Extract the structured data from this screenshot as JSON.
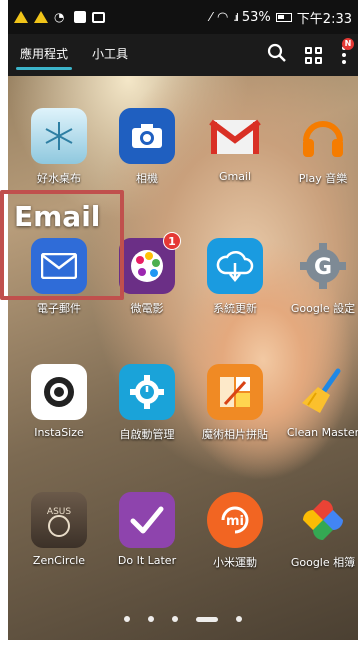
{
  "status_bar": {
    "battery": "53%",
    "time": "下午2:33"
  },
  "app_bar": {
    "tabs": [
      {
        "label": "應用程式",
        "active": true
      },
      {
        "label": "小工具",
        "active": false
      }
    ],
    "more_badge": "N"
  },
  "apps": [
    {
      "label": "好水桌布",
      "icon": "snowflake-wallpaper-icon"
    },
    {
      "label": "相機",
      "icon": "camera-icon"
    },
    {
      "label": "Gmail",
      "icon": "gmail-icon"
    },
    {
      "label": "Play 音樂",
      "icon": "headphones-icon"
    },
    {
      "label": "電子郵件",
      "icon": "email-envelope-icon"
    },
    {
      "label": "微電影",
      "icon": "film-palette-icon",
      "badge": "1"
    },
    {
      "label": "系統更新",
      "icon": "cloud-download-icon"
    },
    {
      "label": "Google 設定",
      "icon": "google-settings-icon"
    },
    {
      "label": "InstaSize",
      "icon": "instasize-lens-icon"
    },
    {
      "label": "自啟動管理",
      "icon": "gear-power-icon"
    },
    {
      "label": "魔術相片拼貼",
      "icon": "photo-collage-icon"
    },
    {
      "label": "Clean Master",
      "icon": "broom-icon"
    },
    {
      "label": "ZenCircle",
      "icon": "zencircle-icon"
    },
    {
      "label": "Do It Later",
      "icon": "checkmark-icon"
    },
    {
      "label": "小米運動",
      "icon": "mi-sport-icon"
    },
    {
      "label": "Google 相簿",
      "icon": "pinwheel-icon"
    }
  ],
  "annotation": {
    "label": "Email",
    "color": "#c0504d"
  },
  "page_dots": [
    {
      "active": false
    },
    {
      "active": false
    },
    {
      "active": false
    },
    {
      "active": true
    },
    {
      "active": false
    }
  ]
}
